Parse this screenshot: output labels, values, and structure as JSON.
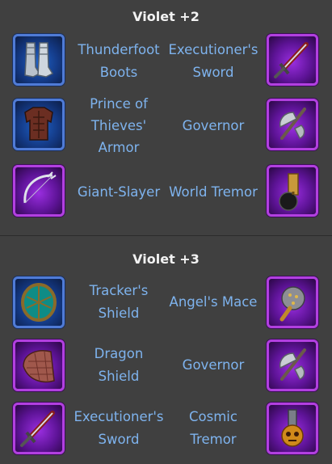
{
  "sections": [
    {
      "title": "Violet +2",
      "rows": [
        {
          "left_icon": "thunderfoot-boots-icon",
          "left_name": "Thunderfoot Boots",
          "right_name": "Executioner's Sword",
          "right_icon": "executioners-sword-icon"
        },
        {
          "left_icon": "prince-of-thieves-armor-icon",
          "left_name": "Prince of Thieves' Armor",
          "right_name": "Governor",
          "right_icon": "governor-axe-icon"
        },
        {
          "left_icon": "giant-slayer-bow-icon",
          "left_name": "Giant-Slayer",
          "right_name": "World Tremor",
          "right_icon": "world-tremor-hammer-icon"
        }
      ]
    },
    {
      "title": "Violet +3",
      "rows": [
        {
          "left_icon": "trackers-shield-icon",
          "left_name": "Tracker's Shield",
          "right_name": "Angel's Mace",
          "right_icon": "angels-mace-icon"
        },
        {
          "left_icon": "dragon-shield-icon",
          "left_name": "Dragon Shield",
          "right_name": "Governor",
          "right_icon": "governor-axe-icon"
        },
        {
          "left_icon": "executioners-sword-icon",
          "left_name": "Executioner's Sword",
          "right_name": "Cosmic Tremor",
          "right_icon": "cosmic-tremor-hammer-icon"
        }
      ]
    }
  ],
  "colors": {
    "background": "#404040",
    "title": "#f2f2f2",
    "item_name": "#7eb3ee",
    "blue_frame": "#4f7bd6",
    "purple_frame": "#b23fe0"
  }
}
